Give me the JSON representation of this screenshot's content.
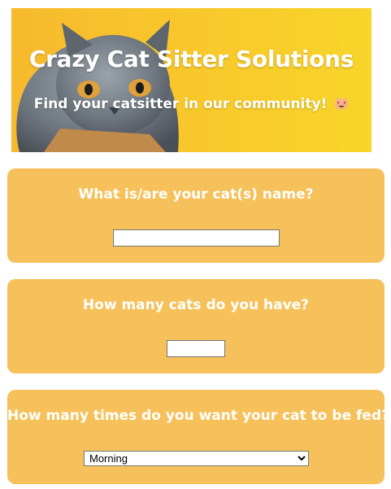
{
  "hero": {
    "title": "Crazy Cat Sitter Solutions",
    "subtitle": "Find your catsitter in our community!",
    "emoji_icon": "heart-eyes-cat-emoji"
  },
  "form": {
    "cat_name": {
      "question": "What is/are your cat(s) name?",
      "value": ""
    },
    "cat_count": {
      "question": "How many cats do you have?",
      "value": ""
    },
    "feeding": {
      "question": "How many times do you want your cat to be fed?",
      "selected": "Morning",
      "options": [
        "Morning"
      ]
    }
  },
  "colors": {
    "hero_bg": "#f8c52b",
    "card_bg": "#f6c15a",
    "text": "#ffffff"
  }
}
